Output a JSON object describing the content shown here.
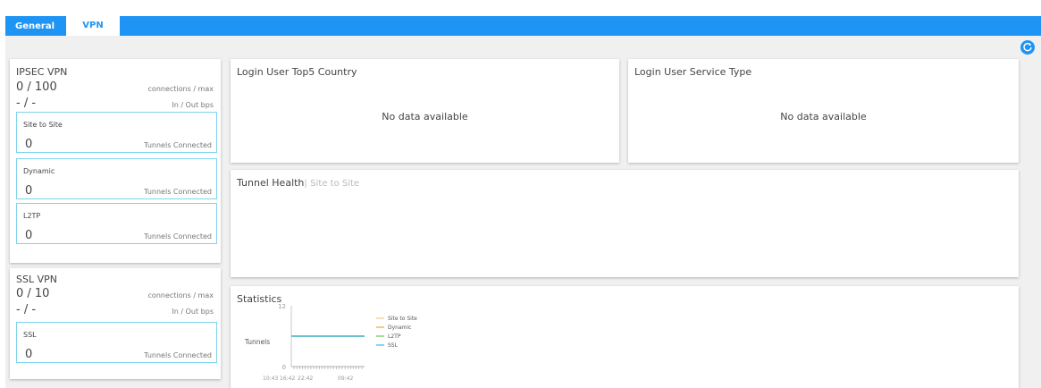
{
  "tabs": {
    "general": "General",
    "vpn": "VPN"
  },
  "colors": {
    "accent": "#1e95f5",
    "tunnel_border": "#7fd3ee"
  },
  "refresh_icon": "refresh-icon",
  "ipsec": {
    "title": "IPSEC VPN",
    "connections": "0 / 100",
    "connections_unit": "connections / max",
    "bps": "- / -",
    "bps_unit": "In / Out bps",
    "tunnels": [
      {
        "label": "Site to Site",
        "value": "0",
        "unit": "Tunnels Connected"
      },
      {
        "label": "Dynamic",
        "value": "0",
        "unit": "Tunnels Connected"
      },
      {
        "label": "L2TP",
        "value": "0",
        "unit": "Tunnels Connected"
      }
    ]
  },
  "ssl": {
    "title": "SSL VPN",
    "connections": "0 / 10",
    "connections_unit": "connections / max",
    "bps": "- / -",
    "bps_unit": "In / Out bps",
    "tunnels": [
      {
        "label": "SSL",
        "value": "0",
        "unit": "Tunnels Connected"
      }
    ]
  },
  "top5": {
    "title": "Login User Top5 Country",
    "empty": "No data available"
  },
  "service_type": {
    "title": "Login User Service Type",
    "empty": "No data available"
  },
  "tunnel_health": {
    "title": "Tunnel Health",
    "separator": "|",
    "subtitle": "Site to Site"
  },
  "statistics": {
    "title": "Statistics",
    "chart_data": {
      "type": "line",
      "ylabel": "Tunnels",
      "ylim": [
        0,
        12
      ],
      "y_ticks": [
        "12",
        "0"
      ],
      "x_tick_labels": [
        "10:43",
        "16:42",
        "22:42",
        "09:42"
      ],
      "legend_position": "right",
      "series": [
        {
          "name": "Site to Site",
          "color": "#f5c88a",
          "values": [
            6,
            6
          ]
        },
        {
          "name": "Dynamic",
          "color": "#f0a830",
          "values": [
            6,
            6
          ]
        },
        {
          "name": "L2TP",
          "color": "#6cc24a",
          "values": [
            6,
            6
          ]
        },
        {
          "name": "SSL",
          "color": "#29b6f6",
          "values": [
            6,
            6
          ]
        }
      ]
    }
  }
}
